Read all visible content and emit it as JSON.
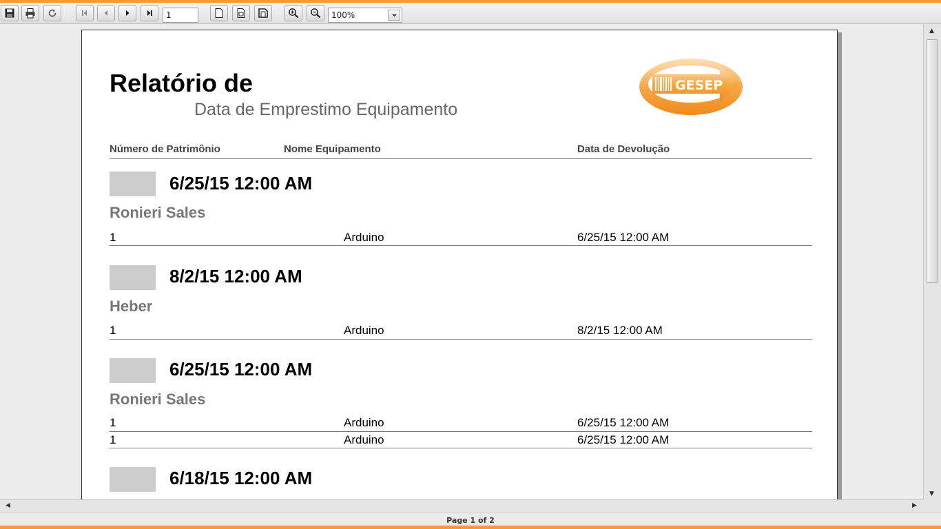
{
  "colors": {
    "accent": "#f39c32",
    "page_bg": "#ffffff",
    "group_box": "#cccccc",
    "subtitle_text": "#666666",
    "name_text": "#777777"
  },
  "toolbar": {
    "save_icon": "save-icon",
    "print_icon": "print-icon",
    "reload_icon": "reload-icon",
    "first_icon": "first-page-icon",
    "prev_icon": "previous-page-icon",
    "next_icon": "next-page-icon",
    "last_icon": "last-page-icon",
    "page_value": "1",
    "actual_size_icon": "actual-size-icon",
    "fit_width_icon": "fit-width-icon",
    "fit_page_icon": "fit-page-icon",
    "zoom_in_icon": "zoom-in-icon",
    "zoom_out_icon": "zoom-out-icon",
    "zoom_value": "100%"
  },
  "report": {
    "title": "Relatório de",
    "subtitle": "Data de Emprestimo Equipamento",
    "logo_text": "GESEP",
    "columns": {
      "asset_number": "Número de Patrimônio",
      "equipment_name": "Nome Equipamento",
      "return_date": "Data de Devolução"
    },
    "groups": [
      {
        "date": "6/25/15 12:00 AM",
        "name": "Ronieri Sales",
        "rows": [
          {
            "asset": "1",
            "equipment": "Arduino",
            "return": "6/25/15 12:00 AM"
          }
        ]
      },
      {
        "date": "8/2/15 12:00 AM",
        "name": "Heber",
        "rows": [
          {
            "asset": "1",
            "equipment": "Arduino",
            "return": "8/2/15 12:00 AM"
          }
        ]
      },
      {
        "date": "6/25/15 12:00 AM",
        "name": "Ronieri Sales",
        "rows": [
          {
            "asset": "1",
            "equipment": "Arduino",
            "return": "6/25/15 12:00 AM"
          },
          {
            "asset": "1",
            "equipment": "Arduino",
            "return": "6/25/15 12:00 AM"
          }
        ]
      },
      {
        "date": "6/18/15 12:00 AM",
        "name": "",
        "rows": []
      }
    ]
  },
  "status": {
    "page_label": "Page 1 of 2"
  }
}
